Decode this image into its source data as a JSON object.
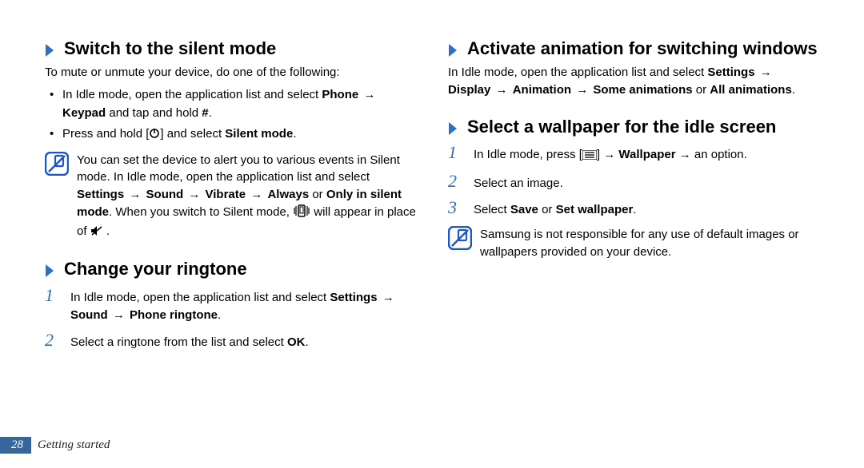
{
  "left": {
    "silent": {
      "title": "Switch to the silent mode",
      "intro": "To mute or unmute your device, do one of the following:",
      "bullets": [
        {
          "pre": "In Idle mode, open the application list and select ",
          "b1": "Phone",
          "arrow": " → ",
          "b2": "Keypad",
          "post": " and tap and hold ",
          "b3": "#",
          "end": "."
        },
        {
          "pre": "Press and hold [",
          "post": "] and select ",
          "b1": "Silent mode",
          "end": "."
        }
      ],
      "note": {
        "l1": "You can set the device to alert you to various events in Silent mode. In Idle mode, open the application list and select ",
        "b1": "Settings",
        "a1": " → ",
        "b2": "Sound",
        "a2": " → ",
        "b3": "Vibrate",
        "a3": " → ",
        "b4": "Always",
        "or": " or ",
        "b5": "Only in silent mode",
        "l2": ". When you switch to Silent mode, ",
        "l3": " will appear in place of ",
        "l4": " ."
      }
    },
    "ringtone": {
      "title": "Change your ringtone",
      "steps": [
        {
          "n": "1",
          "pre": "In Idle mode, open the application list and select ",
          "b1": "Settings",
          "a1": " → ",
          "b2": "Sound",
          "a2": " → ",
          "b3": "Phone ringtone",
          "end": "."
        },
        {
          "n": "2",
          "pre": "Select a ringtone from the list and select ",
          "b1": "OK",
          "end": "."
        }
      ]
    }
  },
  "right": {
    "anim": {
      "title": "Activate animation for switching windows",
      "pre": "In Idle mode, open the application list and select ",
      "b1": "Settings",
      "a1": " → ",
      "b2": "Display",
      "a2": " → ",
      "b3": "Animation",
      "a3": " → ",
      "b4": "Some animations",
      "or": " or ",
      "b5": "All animations",
      "end": "."
    },
    "wallpaper": {
      "title": "Select a wallpaper for the idle screen",
      "steps": [
        {
          "n": "1",
          "pre": "In Idle mode, press [",
          "mid": "] → ",
          "b1": "Wallpaper",
          "a1": " → an option."
        },
        {
          "n": "2",
          "pre": "Select an image."
        },
        {
          "n": "3",
          "pre": "Select ",
          "b1": "Save",
          "or": " or ",
          "b2": "Set wallpaper",
          "end": "."
        }
      ],
      "note": "Samsung is not responsible for any use of default images or wallpapers provided on your device."
    }
  },
  "footer": {
    "page": "28",
    "section": "Getting started"
  }
}
